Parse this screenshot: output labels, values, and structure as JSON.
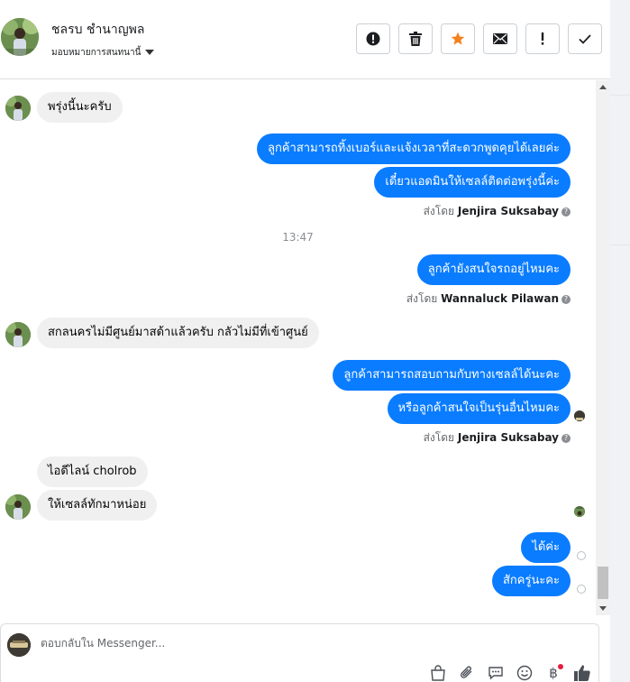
{
  "header": {
    "contact_name": "ชลรบ ชำนาญพล",
    "assign_label": "มอบหมายการสนทนานี้",
    "actions": [
      {
        "name": "alert-icon",
        "label": "!"
      },
      {
        "name": "trash-icon",
        "label": ""
      },
      {
        "name": "star-icon",
        "label": ""
      },
      {
        "name": "mail-icon",
        "label": ""
      },
      {
        "name": "exclamation-icon",
        "label": "!"
      },
      {
        "name": "check-icon",
        "label": ""
      }
    ],
    "accent_color": "#f5811f"
  },
  "messages": [
    {
      "dir": "in",
      "text": "พรุ่งนี้นะครับ"
    },
    {
      "dir": "out",
      "text": "ลูกค้าสามารถทิ้งเบอร์และแจ้งเวลาที่สะดวกพูดคุยได้เลยค่ะ"
    },
    {
      "dir": "out",
      "text": "เดี๋ยวแอดมินให้เซลล์ติดต่อพรุ่งนี้ค่ะ"
    },
    {
      "dir": "meta",
      "sent_by_prefix": "ส่งโดย",
      "sent_by": "Jenjira Suksabay"
    },
    {
      "dir": "time",
      "text": "13:47"
    },
    {
      "dir": "out",
      "text": "ลูกค้ายังสนใจรถอยู่ไหมคะ"
    },
    {
      "dir": "meta",
      "sent_by_prefix": "ส่งโดย",
      "sent_by": "Wannaluck Pilawan"
    },
    {
      "dir": "in",
      "text": "สกลนครไม่มีศูนย์มาสด้าแล้วครับ  กลัวไม่มีที่เข้าศูนย์"
    },
    {
      "dir": "out",
      "text": "ลูกค้าสามารถสอบถามกับทางเซลล์ได้นะคะ"
    },
    {
      "dir": "out",
      "text": "หรือลูกค้าสนใจเป็นรุ่นอื่นไหมคะ"
    },
    {
      "dir": "meta",
      "sent_by_prefix": "ส่งโดย",
      "sent_by": "Jenjira Suksabay"
    },
    {
      "dir": "in",
      "text": "ไอดีไลน์  cholrob"
    },
    {
      "dir": "in",
      "text": "ให้เซลล์ทักมาหน่อย"
    },
    {
      "dir": "out",
      "text": "ได้ค่ะ"
    },
    {
      "dir": "out",
      "text": "สักครู่นะคะ"
    }
  ],
  "composer": {
    "placeholder": "ตอบกลับใน Messenger...",
    "tools": [
      "shopping-bag-icon",
      "attachment-icon",
      "saved-reply-icon",
      "emoji-icon",
      "baht-payment-icon",
      "like-icon"
    ],
    "baht_symbol": "฿"
  },
  "colors": {
    "outgoing_bubble": "#0a7cff",
    "incoming_bubble": "#f0f0f0"
  }
}
